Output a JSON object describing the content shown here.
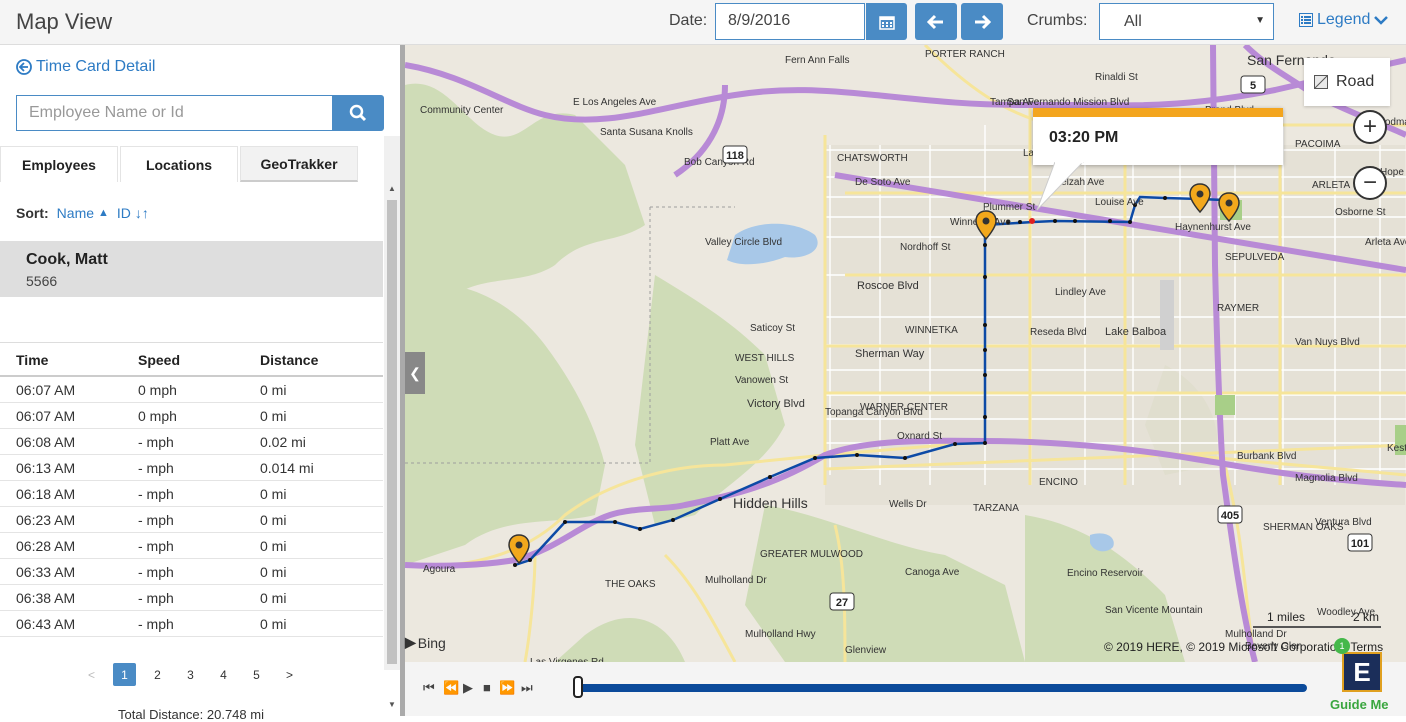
{
  "header": {
    "title": "Map View",
    "date_label": "Date:",
    "date_value": "8/9/2016",
    "crumbs_label": "Crumbs:",
    "crumbs_value": "All",
    "legend_label": "Legend"
  },
  "left": {
    "back_link": "Time Card Detail",
    "search_placeholder": "Employee Name or Id",
    "tabs": [
      "Employees",
      "Locations",
      "GeoTrakker"
    ],
    "sort_label": "Sort:",
    "sort_name": "Name",
    "sort_id": "ID",
    "employee": {
      "name": "Cook, Matt",
      "id": "5566"
    },
    "columns": [
      "Time",
      "Speed",
      "Distance"
    ],
    "rows": [
      [
        "06:07 AM",
        "0 mph",
        "0 mi"
      ],
      [
        "06:07 AM",
        "0 mph",
        "0 mi"
      ],
      [
        "06:08 AM",
        "- mph",
        "0.02 mi"
      ],
      [
        "06:13 AM",
        "- mph",
        "0.014 mi"
      ],
      [
        "06:18 AM",
        "- mph",
        "0 mi"
      ],
      [
        "06:23 AM",
        "- mph",
        "0 mi"
      ],
      [
        "06:28 AM",
        "- mph",
        "0 mi"
      ],
      [
        "06:33 AM",
        "- mph",
        "0 mi"
      ],
      [
        "06:38 AM",
        "- mph",
        "0 mi"
      ],
      [
        "06:43 AM",
        "- mph",
        "0 mi"
      ]
    ],
    "pager": {
      "prev": "<",
      "pages": [
        "1",
        "2",
        "3",
        "4",
        "5"
      ],
      "next": ">"
    },
    "total_distance": "Total Distance: 20.748 mi"
  },
  "map": {
    "road_toggle": "Road",
    "popup_time": "03:20 PM",
    "scale_miles": "1 miles",
    "scale_km": "2 km",
    "copyright": "© 2019 HERE, © 2019 Microsoft Corporation",
    "terms": "Terms",
    "bing": "Bing",
    "labels": [
      "Fern Ann Falls",
      "PORTER RANCH",
      "San Fernando",
      "Rinaldi St",
      "San Fernando Mission Blvd",
      "Brand Blvd",
      "Community Center",
      "E Los Angeles Ave",
      "Santa Susana Knolls",
      "CHATSWORTH",
      "Lassen St",
      "Plummer St",
      "Nordhoff St",
      "Roscoe Blvd",
      "Saticoy St",
      "WINNETKA",
      "Sherman Way",
      "WEST HILLS",
      "Vanowen St",
      "Victory Blvd",
      "WARNER CENTER",
      "Oxnard St",
      "Hidden Hills",
      "Wells Dr",
      "TARZANA",
      "ENCINO",
      "Burbank Blvd",
      "Magnolia Blvd",
      "GREATER MULWOOD",
      "THE OAKS",
      "Agoura",
      "Encino Reservoir",
      "San Vicente Mountain",
      "Glenview",
      "Beverly Glen",
      "Lake Balboa",
      "SEPULVEDA",
      "RAYMER",
      "PACOIMA",
      "ARLETA",
      "Kester",
      "SHERMAN OAKS",
      "Ventura Blvd",
      "Mulholland Dr",
      "Las Virgenes Rd",
      "Van Nuys Blvd",
      "Reseda Blvd",
      "Topanga Canyon Blvd",
      "Woodley Ave",
      "Osborne St",
      "Lindley Ave",
      "Haynenhurst Ave",
      "Canoga Ave",
      "De Soto Ave",
      "Winnetka Ave",
      "Valley Circle Blvd",
      "Platt Ave",
      "Louise Ave",
      "Zelzah Ave",
      "Tampa Ave",
      "Woodman Ave",
      "Bob Canyon Rd",
      "Arleta Ave",
      "Mulholland Hwy",
      "Mulholland Dr",
      "Hope St"
    ],
    "shields": [
      "118",
      "5",
      "405",
      "101",
      "27"
    ]
  },
  "playback": {
    "guide_label": "Guide Me",
    "guide_badge": "1",
    "guide_letter": "E"
  }
}
